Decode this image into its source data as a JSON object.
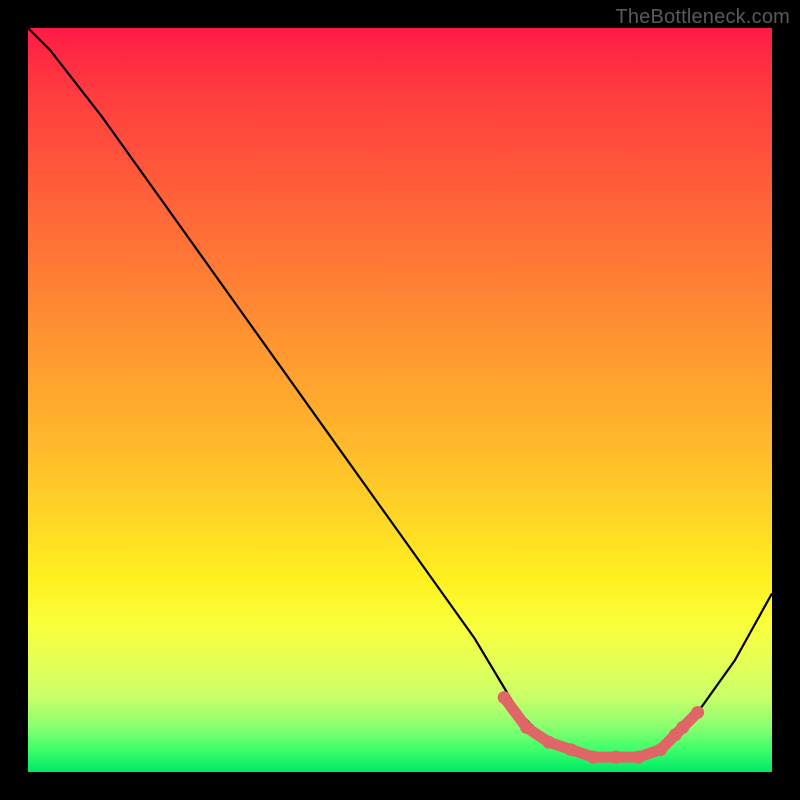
{
  "watermark": "TheBottleneck.com",
  "chart_data": {
    "type": "line",
    "title": "",
    "xlabel": "",
    "ylabel": "",
    "xlim": [
      0,
      1
    ],
    "ylim": [
      0,
      1
    ],
    "series": [
      {
        "name": "bottleneck-curve",
        "x": [
          0.0,
          0.03,
          0.1,
          0.2,
          0.3,
          0.4,
          0.5,
          0.6,
          0.66,
          0.7,
          0.75,
          0.8,
          0.85,
          0.9,
          0.95,
          1.0
        ],
        "y": [
          1.0,
          0.97,
          0.88,
          0.74,
          0.6,
          0.46,
          0.32,
          0.18,
          0.08,
          0.04,
          0.02,
          0.02,
          0.03,
          0.08,
          0.15,
          0.24
        ]
      },
      {
        "name": "highlighted-minimum",
        "x": [
          0.64,
          0.67,
          0.7,
          0.73,
          0.76,
          0.79,
          0.82,
          0.85,
          0.87,
          0.88,
          0.9
        ],
        "y": [
          0.1,
          0.06,
          0.04,
          0.03,
          0.02,
          0.02,
          0.02,
          0.03,
          0.05,
          0.06,
          0.08
        ]
      }
    ],
    "colors": {
      "curve": "#000000",
      "highlight": "#e06666",
      "gradient_top": "#ff1a47",
      "gradient_mid": "#ffd726",
      "gradient_bottom": "#00e865"
    }
  }
}
